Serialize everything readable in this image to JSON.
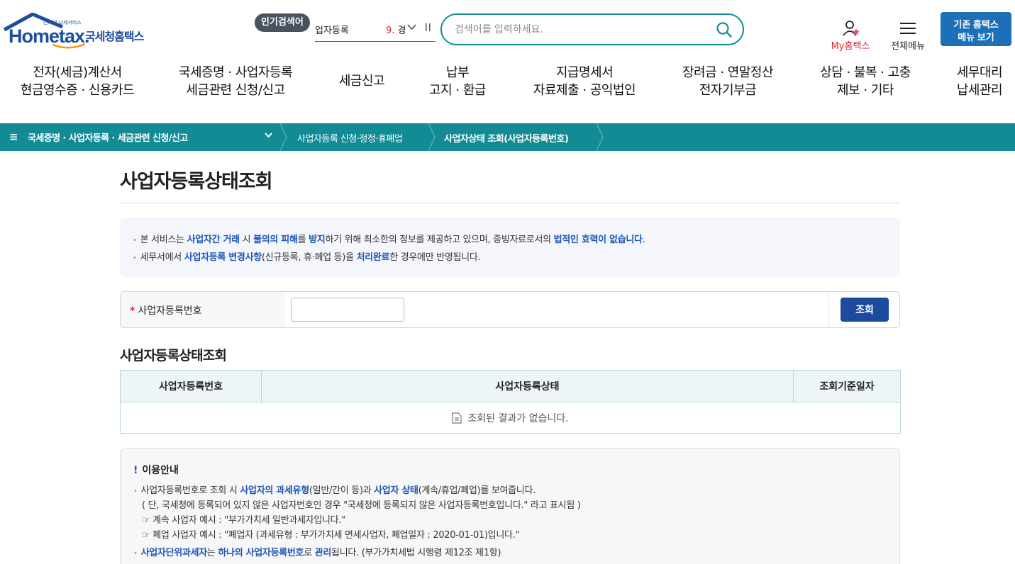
{
  "logo": {
    "brand": "Hometax.",
    "sub": "인터넷 납세서비스",
    "kr": "국세청홈택스"
  },
  "header": {
    "popular_label": "인기검색어",
    "popular_keyword": "업자등록",
    "popular_rank": "9.",
    "popular_rank_text": "경",
    "search_placeholder": "검색어를 입력하세요.",
    "my_hometax": "My홈택스",
    "all_menu": "전체메뉴",
    "legacy_line1": "기존 홈택스",
    "legacy_line2": "메뉴 보기"
  },
  "gnb": [
    {
      "l1": "전자(세금)계산서",
      "l2": "현금영수증 · 신용카드"
    },
    {
      "l1": "국세증명 · 사업자등록",
      "l2": "세금관련 신청/신고"
    },
    {
      "l1": "세금신고",
      "l2": ""
    },
    {
      "l1": "납부",
      "l2": "고지 · 환급"
    },
    {
      "l1": "지급명세서",
      "l2": "자료제출 · 공익법인"
    },
    {
      "l1": "장려금 · 연말정산",
      "l2": "전자기부금"
    },
    {
      "l1": "상담 · 불복 · 고충",
      "l2": "제보 · 기타"
    },
    {
      "l1": "세무대리",
      "l2": "납세관리"
    }
  ],
  "breadcrumb": {
    "menu_icon": "≡",
    "level1": "국세증명 · 사업자등록 · 세금관련 신청/신고",
    "level2": "사업자등록 신청·정정·휴폐업",
    "level3": "사업자상태 조회(사업자등록번호)"
  },
  "page": {
    "title": "사업자등록상태조회"
  },
  "notice": {
    "l1": [
      "본 서비스는 ",
      "사업자간 거래",
      " 시 ",
      "불의의 피해",
      "를 ",
      "방지",
      "하기 위해 최소한의 정보를 제공하고 있으며, 증빙자료로서의 ",
      "법적인 효력이 없습니다",
      "."
    ],
    "l2": [
      "세무서에서 ",
      "사업자등록 변경사항",
      "(신규등록, 휴·폐업 등)을 ",
      "처리완료",
      "한 경우에만 반영됩니다."
    ]
  },
  "query": {
    "required_mark": "*",
    "label": "사업자등록번호",
    "input_value": "",
    "button": "조회"
  },
  "result": {
    "title": "사업자등록상태조회",
    "columns": [
      "사업자등록번호",
      "사업자등록상태",
      "조회기준일자"
    ],
    "empty": "조회된 결과가 없습니다."
  },
  "guide": {
    "title_mark": "!",
    "title": "이용안내",
    "l1": [
      "사업자등록번호로 조회 시 ",
      "사업자의 과세유형",
      "(일반/간이 등)과 ",
      "사업자 상태",
      "(계속/휴업/폐업)를 보여줍니다."
    ],
    "l2": "( 단, 국세청에 등록되어 있지 않은 사업자번호인 경우 \"국세청에 등록되지 않은 사업자등록번호입니다.\" 라고 표시됨 )",
    "l3": "☞ 계속 사업자 예시 : \"부가가치세 일반과세자입니다.\"",
    "l4": "☞ 폐업 사업자 예시 : \"폐업자 (과세유형 : 부가가치세 면세사업자, 폐업일자 : 2020-01-01)입니다.\"",
    "l5": [
      "사업자단위과세자",
      "는 ",
      "하나의 사업자등록번호",
      "로 ",
      "관리",
      "됩니다. (부가가치세법 시행령 제12조 제1항)"
    ]
  },
  "colors": {
    "teal": "#128b95",
    "blue_btn": "#1c4a9f",
    "highlight": "#1d56b8",
    "red": "#d9262c"
  }
}
